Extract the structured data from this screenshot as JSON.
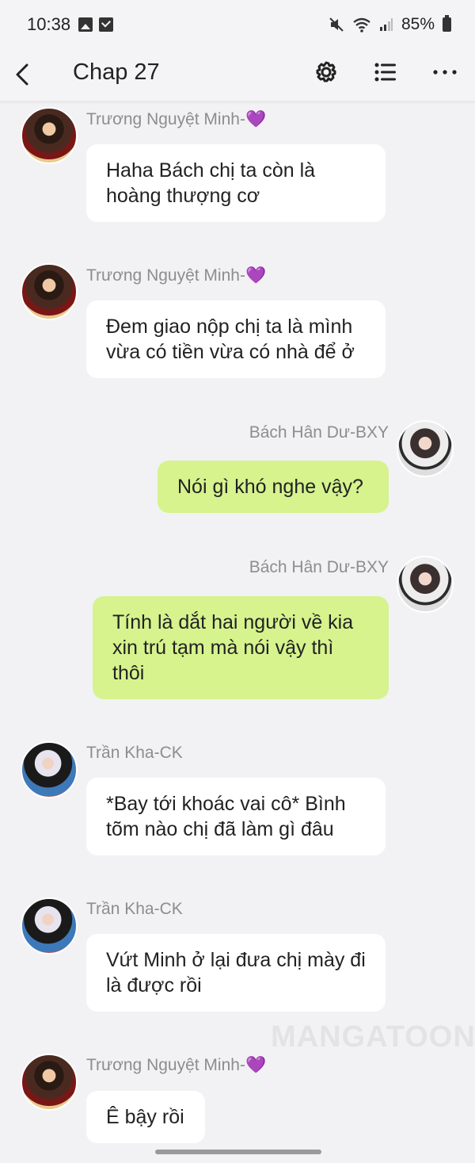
{
  "status_bar": {
    "time": "10:38",
    "battery": "85%"
  },
  "header": {
    "title": "Chap 27"
  },
  "messages": [
    {
      "sender": "Trương Nguyệt Minh-💜",
      "text": "Haha Bách chị ta còn là hoàng thượng cơ"
    },
    {
      "sender": "Trương Nguyệt Minh-💜",
      "text": "Đem giao nộp chị ta là mình vừa có tiền vừa có nhà để ở"
    },
    {
      "sender": "Bách Hân Dư-BXY",
      "text": "Nói gì khó nghe vậy?"
    },
    {
      "sender": "Bách Hân Dư-BXY",
      "text": "Tính là dắt hai người về kia xin trú tạm mà nói vậy thì thôi"
    },
    {
      "sender": "Trần Kha-CK",
      "text": "*Bay tới khoác vai cô* Bình tõm nào chị đã làm gì đâu"
    },
    {
      "sender": "Trần Kha-CK",
      "text": "Vứt Minh ở lại đưa chị mày đi là được rồi"
    },
    {
      "sender": "Trương Nguyệt Minh-💜",
      "text": "Ê bậy rồi"
    }
  ],
  "watermark": "MANGATOON",
  "colors": {
    "incoming_bubble": "#ffffff",
    "outgoing_bubble": "#d6f38e",
    "background": "#f2f2f4"
  }
}
